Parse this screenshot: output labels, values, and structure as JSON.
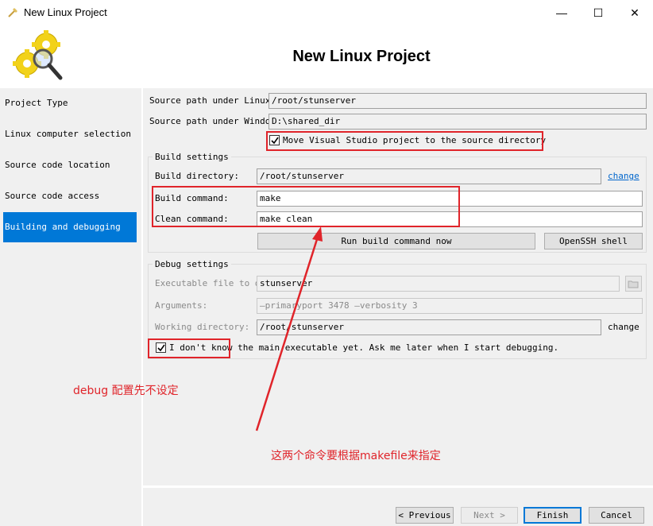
{
  "window": {
    "title": "New Linux Project",
    "minimize_glyph": "—",
    "maximize_glyph": "☐",
    "close_glyph": "✕"
  },
  "header": {
    "title": "New Linux Project"
  },
  "sidebar": {
    "items": [
      {
        "label": "Project Type",
        "active": false
      },
      {
        "label": "Linux computer selection",
        "active": false
      },
      {
        "label": "Source code location",
        "active": false
      },
      {
        "label": "Source code access",
        "active": false
      },
      {
        "label": "Building and debugging",
        "active": true
      }
    ]
  },
  "source": {
    "linux_label": "Source path under Linux:",
    "linux_value": "/root/stunserver",
    "windows_label": "Source path under Windows:",
    "windows_value": "D:\\shared_dir",
    "move_checkbox_label": "Move Visual Studio project to the source directory",
    "move_checked": true
  },
  "build": {
    "group_title": "Build settings",
    "dir_label": "Build directory:",
    "dir_value": "/root/stunserver",
    "change_link": "change",
    "build_cmd_label": "Build command:",
    "build_cmd_value": "make",
    "clean_cmd_label": "Clean command:",
    "clean_cmd_value": "make clean",
    "run_button": "Run build command now",
    "ssh_button": "OpenSSH shell"
  },
  "debug": {
    "group_title": "Debug settings",
    "exe_label": "Executable file to debug:",
    "exe_value": "stunserver",
    "args_label": "Arguments:",
    "args_value": "—primaryport 3478 —verbosity 3",
    "workdir_label": "Working directory:",
    "workdir_value": "/root/stunserver",
    "change_label": "change",
    "later_checkbox_label": "I don't know the main executable yet. Ask me later when I start debugging.",
    "later_checked": true
  },
  "annotations": {
    "debug_note": "debug 配置先不设定",
    "cmd_note": "这两个命令要根据makefile来指定",
    "color": "#e0242a"
  },
  "footer": {
    "previous": "Previous",
    "next": "Next",
    "finish": "Finish",
    "cancel": "Cancel"
  },
  "colors": {
    "accent": "#0078d7",
    "panel": "#f0f0f0",
    "annotation": "#e0242a"
  }
}
